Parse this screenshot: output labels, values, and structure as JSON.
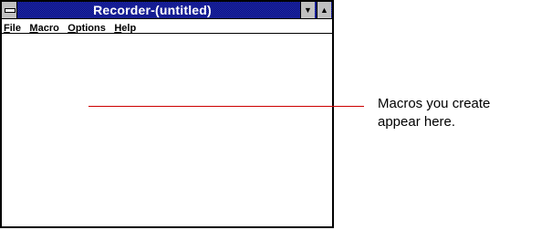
{
  "window": {
    "title": "Recorder-(untitled)",
    "menu": [
      {
        "mnemonic": "F",
        "rest": "ile"
      },
      {
        "mnemonic": "M",
        "rest": "acro"
      },
      {
        "mnemonic": "O",
        "rest": "ptions"
      },
      {
        "mnemonic": "H",
        "rest": "elp"
      }
    ],
    "controls": {
      "system_menu_icon": "system-menu-bar-icon",
      "minimize_icon": "triangle-down-icon",
      "maximize_icon": "triangle-up-icon",
      "minimize_glyph": "▼",
      "maximize_glyph": "▲"
    },
    "colors": {
      "titlebar": "#000080",
      "callout_line": "#cc0000"
    }
  },
  "callout": {
    "line1": "Macros you create",
    "line2": "appear here."
  }
}
